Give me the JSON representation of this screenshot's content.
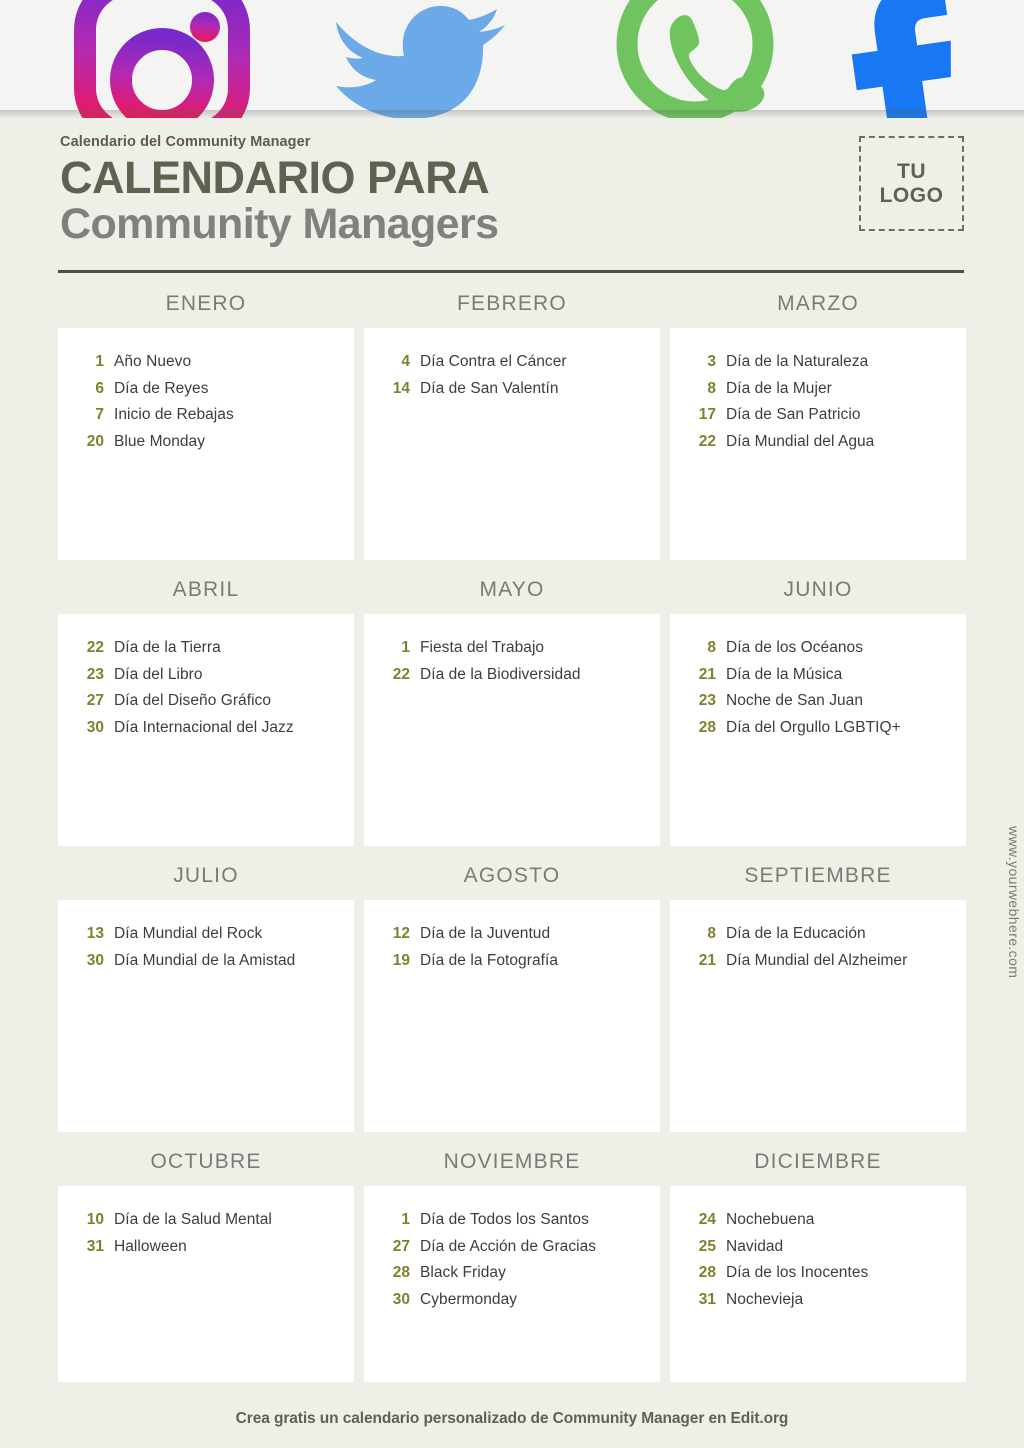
{
  "banner": {
    "icons": [
      {
        "name": "instagram-icon",
        "label": "Instagram",
        "color": "#c32aa3"
      },
      {
        "name": "twitter-icon",
        "label": "Twitter",
        "color": "#6ca9e8"
      },
      {
        "name": "whatsapp-icon",
        "label": "WhatsApp",
        "color": "#6fc45f"
      },
      {
        "name": "facebook-icon",
        "label": "Facebook",
        "color": "#1877f2"
      }
    ]
  },
  "header": {
    "eyebrow": "Calendario del Community Manager",
    "title_main": "CALENDARIO PARA",
    "title_sub": "Community Managers",
    "logo_line1": "TU",
    "logo_line2": "LOGO"
  },
  "sidebar": {
    "website": "www.yourwebhere.com"
  },
  "footer": {
    "text": "Crea gratis un calendario personalizado de Community Manager en Edit.org"
  },
  "colors": {
    "background": "#eef0e8",
    "card": "#ffffff",
    "day_number": "#80802e",
    "event_text": "#3d3d3d",
    "month_title": "#7b7b76",
    "title_dark": "#5d6350",
    "title_gray": "#808080"
  },
  "months": [
    {
      "name": "ENERO",
      "events": [
        {
          "day": "1",
          "name": "Año Nuevo"
        },
        {
          "day": "6",
          "name": "Día de Reyes"
        },
        {
          "day": "7",
          "name": "Inicio de Rebajas"
        },
        {
          "day": "20",
          "name": "Blue Monday"
        }
      ]
    },
    {
      "name": "FEBRERO",
      "events": [
        {
          "day": "4",
          "name": "Día Contra el Cáncer"
        },
        {
          "day": "14",
          "name": "Día de San Valentín"
        }
      ]
    },
    {
      "name": "MARZO",
      "events": [
        {
          "day": "3",
          "name": "Día de la Naturaleza"
        },
        {
          "day": "8",
          "name": "Día de la Mujer"
        },
        {
          "day": "17",
          "name": "Día de San Patricio"
        },
        {
          "day": "22",
          "name": "Día Mundial del Agua"
        }
      ]
    },
    {
      "name": "ABRIL",
      "events": [
        {
          "day": "22",
          "name": "Día de la Tierra"
        },
        {
          "day": "23",
          "name": "Día del Libro"
        },
        {
          "day": "27",
          "name": "Día del Diseño Gráfico"
        },
        {
          "day": "30",
          "name": "Día Internacional del Jazz"
        }
      ]
    },
    {
      "name": "MAYO",
      "events": [
        {
          "day": "1",
          "name": "Fiesta del Trabajo"
        },
        {
          "day": "22",
          "name": "Día de la Biodiversidad"
        }
      ]
    },
    {
      "name": "JUNIO",
      "events": [
        {
          "day": "8",
          "name": "Día de los Océanos"
        },
        {
          "day": "21",
          "name": "Día de la Música"
        },
        {
          "day": "23",
          "name": "Noche de San Juan"
        },
        {
          "day": "28",
          "name": "Día del Orgullo LGBTIQ+"
        }
      ]
    },
    {
      "name": "JULIO",
      "events": [
        {
          "day": "13",
          "name": "Día Mundial del Rock"
        },
        {
          "day": "30",
          "name": "Día Mundial de la Amistad"
        }
      ]
    },
    {
      "name": "AGOSTO",
      "events": [
        {
          "day": "12",
          "name": "Día de la Juventud"
        },
        {
          "day": "19",
          "name": "Día de la Fotografía"
        }
      ]
    },
    {
      "name": "SEPTIEMBRE",
      "events": [
        {
          "day": "8",
          "name": "Día de la Educación"
        },
        {
          "day": "21",
          "name": "Día Mundial del Alzheimer"
        }
      ]
    },
    {
      "name": "OCTUBRE",
      "events": [
        {
          "day": "10",
          "name": "Día de la Salud Mental"
        },
        {
          "day": "31",
          "name": "Halloween"
        }
      ]
    },
    {
      "name": "NOVIEMBRE",
      "events": [
        {
          "day": "1",
          "name": "Día de Todos los Santos"
        },
        {
          "day": "27",
          "name": "Día de Acción de Gracias"
        },
        {
          "day": "28",
          "name": "Black Friday"
        },
        {
          "day": "30",
          "name": "Cybermonday"
        }
      ]
    },
    {
      "name": "DICIEMBRE",
      "events": [
        {
          "day": "24",
          "name": "Nochebuena"
        },
        {
          "day": "25",
          "name": "Navidad"
        },
        {
          "day": "28",
          "name": "Día de los Inocentes"
        },
        {
          "day": "31",
          "name": "Nochevieja"
        }
      ]
    }
  ]
}
